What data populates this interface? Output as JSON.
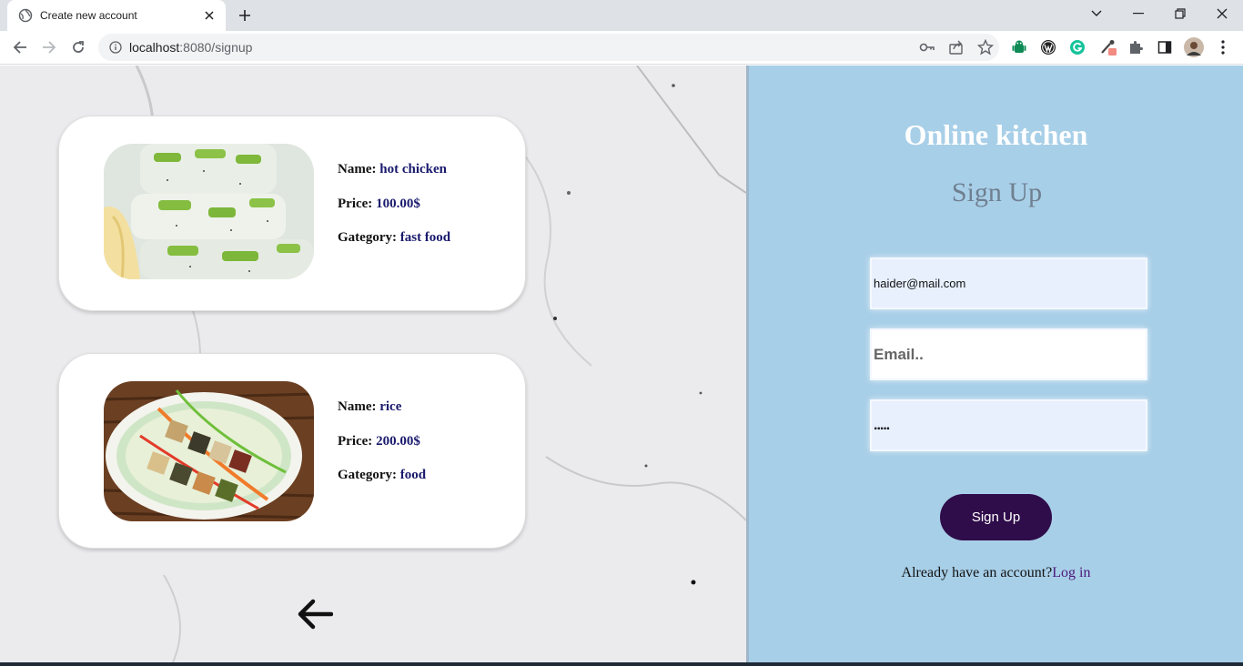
{
  "browser": {
    "tab_title": "Create new account",
    "url_host": "localhost",
    "url_rest": ":8080/signup"
  },
  "foods": [
    {
      "name_label": "Name:",
      "name": "hot chicken",
      "price_label": "Price:",
      "price": "100.00$",
      "category_label": "Gategory:",
      "category": "fast food",
      "image": "sushi-rolls-photo"
    },
    {
      "name_label": "Name:",
      "name": "rice",
      "price_label": "Price:",
      "price": "200.00$",
      "category_label": "Gategory:",
      "category": "food",
      "image": "vegetable-skewers-photo"
    }
  ],
  "signup": {
    "brand": "Online kitchen",
    "heading": "Sign Up",
    "username_value": "haider@mail.com",
    "email_placeholder": "Email..",
    "password_value": ".....",
    "submit_label": "Sign Up",
    "already_text": "Already have an account?",
    "login_link": "Log in"
  },
  "colors": {
    "right_panel": "#a8cfe8",
    "button": "#2f0c4a",
    "food_value": "#1a1a6e"
  }
}
